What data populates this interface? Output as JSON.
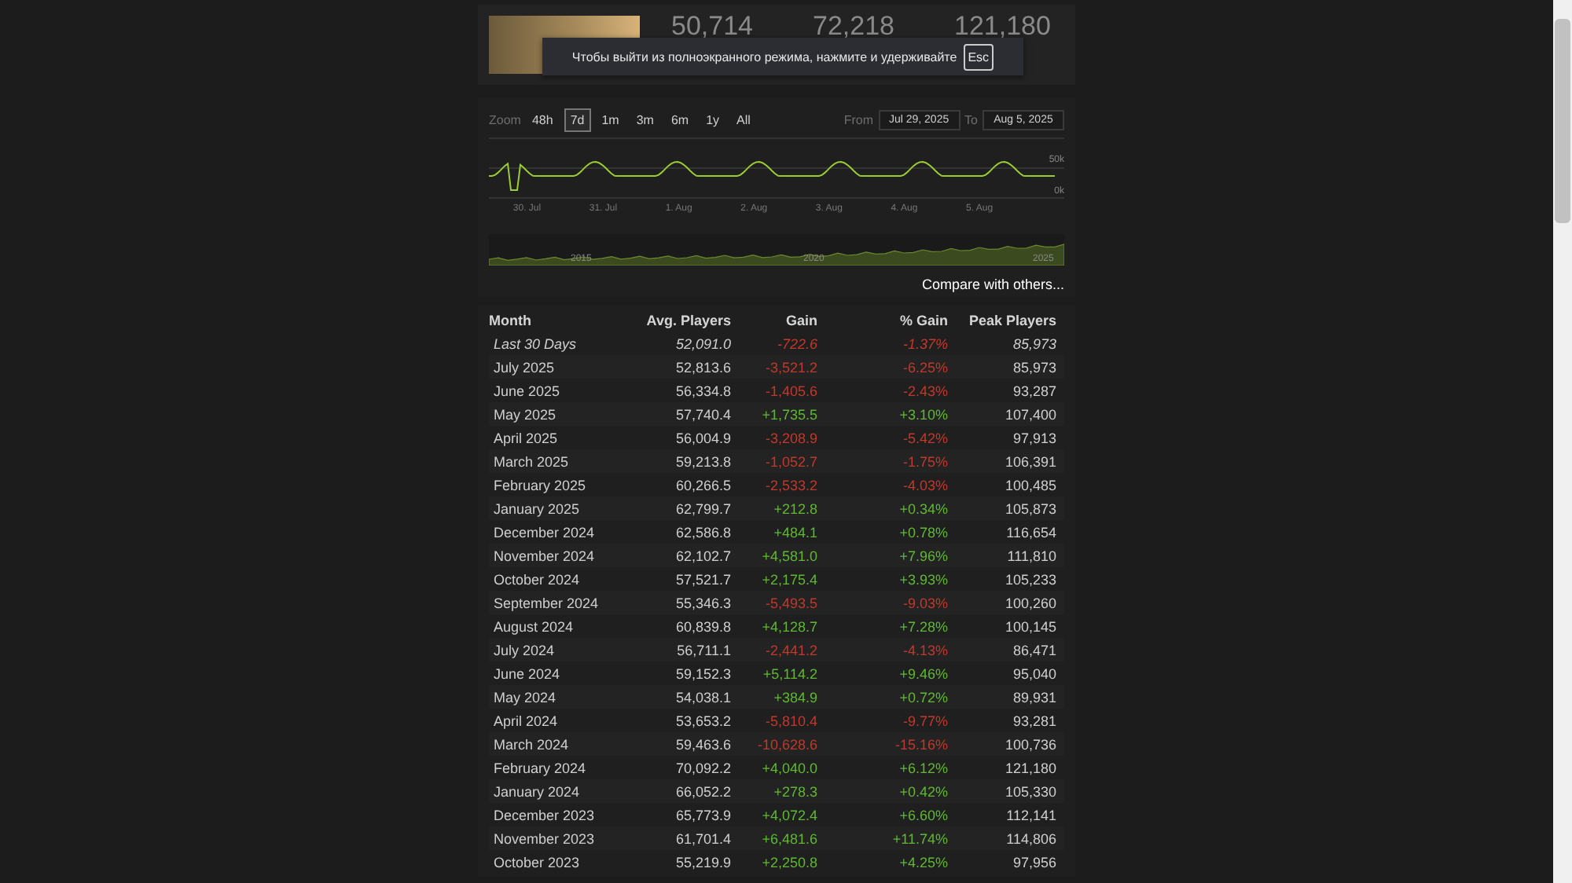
{
  "header": {
    "stats": [
      "50,714",
      "72,218",
      "121,180"
    ]
  },
  "fullscreen_notice": {
    "text": "Чтобы выйти из полноэкранного режима, нажмите и удерживайте",
    "key": "Esc"
  },
  "chart": {
    "zoom_label": "Zoom",
    "zoom_options": [
      {
        "label": "48h",
        "selected": false
      },
      {
        "label": "7d",
        "selected": true
      },
      {
        "label": "1m",
        "selected": false
      },
      {
        "label": "3m",
        "selected": false
      },
      {
        "label": "6m",
        "selected": false
      },
      {
        "label": "1y",
        "selected": false
      },
      {
        "label": "All",
        "selected": false
      }
    ],
    "from_label": "From",
    "from_value": "Jul 29, 2025",
    "to_label": "To",
    "to_value": "Aug 5, 2025",
    "y_labels": [
      "50k",
      "0k"
    ],
    "x_labels": [
      "30. Jul",
      "31. Jul",
      "1. Aug",
      "2. Aug",
      "3. Aug",
      "4. Aug",
      "5. Aug"
    ],
    "navigator_labels": [
      "2015",
      "2020",
      "2025"
    ],
    "compare_link": "Compare with others..."
  },
  "table": {
    "columns": [
      "Month",
      "Avg. Players",
      "Gain",
      "% Gain",
      "Peak Players"
    ],
    "rows": [
      {
        "kind": "summary",
        "month": "Last 30 Days",
        "avg": "52,091.0",
        "gain": "-722.6",
        "pct": "-1.37%",
        "peak": "85,973",
        "color": "#c0392b"
      },
      {
        "kind": "month",
        "month": "July 2025",
        "avg": "52,813.6",
        "gain": "-3,521.2",
        "pct": "-6.25%",
        "peak": "85,973",
        "color": "#c0392b"
      },
      {
        "kind": "month",
        "month": "June 2025",
        "avg": "56,334.8",
        "gain": "-1,405.6",
        "pct": "-2.43%",
        "peak": "93,287",
        "color": "#c0392b"
      },
      {
        "kind": "month",
        "month": "May 2025",
        "avg": "57,740.4",
        "gain": "+1,735.5",
        "pct": "+3.10%",
        "peak": "107,400",
        "color": "#5fb832"
      },
      {
        "kind": "month",
        "month": "April 2025",
        "avg": "56,004.9",
        "gain": "-3,208.9",
        "pct": "-5.42%",
        "peak": "97,913",
        "color": "#c0392b"
      },
      {
        "kind": "month",
        "month": "March 2025",
        "avg": "59,213.8",
        "gain": "-1,052.7",
        "pct": "-1.75%",
        "peak": "106,391",
        "color": "#c0392b"
      },
      {
        "kind": "month",
        "month": "February 2025",
        "avg": "60,266.5",
        "gain": "-2,533.2",
        "pct": "-4.03%",
        "peak": "100,485",
        "color": "#c0392b"
      },
      {
        "kind": "month",
        "month": "January 2025",
        "avg": "62,799.7",
        "gain": "+212.8",
        "pct": "+0.34%",
        "peak": "105,873",
        "color": "#5fb832"
      },
      {
        "kind": "month",
        "month": "December 2024",
        "avg": "62,586.8",
        "gain": "+484.1",
        "pct": "+0.78%",
        "peak": "116,654",
        "color": "#5fb832"
      },
      {
        "kind": "month",
        "month": "November 2024",
        "avg": "62,102.7",
        "gain": "+4,581.0",
        "pct": "+7.96%",
        "peak": "111,810",
        "color": "#5fb832"
      },
      {
        "kind": "month",
        "month": "October 2024",
        "avg": "57,521.7",
        "gain": "+2,175.4",
        "pct": "+3.93%",
        "peak": "105,233",
        "color": "#5fb832"
      },
      {
        "kind": "month",
        "month": "September 2024",
        "avg": "55,346.3",
        "gain": "-5,493.5",
        "pct": "-9.03%",
        "peak": "100,260",
        "color": "#c0392b"
      },
      {
        "kind": "month",
        "month": "August 2024",
        "avg": "60,839.8",
        "gain": "+4,128.7",
        "pct": "+7.28%",
        "peak": "100,145",
        "color": "#5fb832"
      },
      {
        "kind": "month",
        "month": "July 2024",
        "avg": "56,711.1",
        "gain": "-2,441.2",
        "pct": "-4.13%",
        "peak": "86,471",
        "color": "#c0392b"
      },
      {
        "kind": "month",
        "month": "June 2024",
        "avg": "59,152.3",
        "gain": "+5,114.2",
        "pct": "+9.46%",
        "peak": "95,040",
        "color": "#5fb832"
      },
      {
        "kind": "month",
        "month": "May 2024",
        "avg": "54,038.1",
        "gain": "+384.9",
        "pct": "+0.72%",
        "peak": "89,931",
        "color": "#5fb832"
      },
      {
        "kind": "month",
        "month": "April 2024",
        "avg": "53,653.2",
        "gain": "-5,810.4",
        "pct": "-9.77%",
        "peak": "93,281",
        "color": "#c0392b"
      },
      {
        "kind": "month",
        "month": "March 2024",
        "avg": "59,463.6",
        "gain": "-10,628.6",
        "pct": "-15.16%",
        "peak": "100,736",
        "color": "#c0392b"
      },
      {
        "kind": "month",
        "month": "February 2024",
        "avg": "70,092.2",
        "gain": "+4,040.0",
        "pct": "+6.12%",
        "peak": "121,180",
        "color": "#5fb832"
      },
      {
        "kind": "month",
        "month": "January 2024",
        "avg": "66,052.2",
        "gain": "+278.3",
        "pct": "+0.42%",
        "peak": "105,330",
        "color": "#5fb832"
      },
      {
        "kind": "month",
        "month": "December 2023",
        "avg": "65,773.9",
        "gain": "+4,072.4",
        "pct": "+6.60%",
        "peak": "112,141",
        "color": "#5fb832"
      },
      {
        "kind": "month",
        "month": "November 2023",
        "avg": "61,701.4",
        "gain": "+6,481.6",
        "pct": "+11.74%",
        "peak": "114,806",
        "color": "#5fb832"
      },
      {
        "kind": "month",
        "month": "October 2023",
        "avg": "55,219.9",
        "gain": "+2,250.8",
        "pct": "+4.25%",
        "peak": "97,956",
        "color": "#5fb832"
      }
    ]
  }
}
